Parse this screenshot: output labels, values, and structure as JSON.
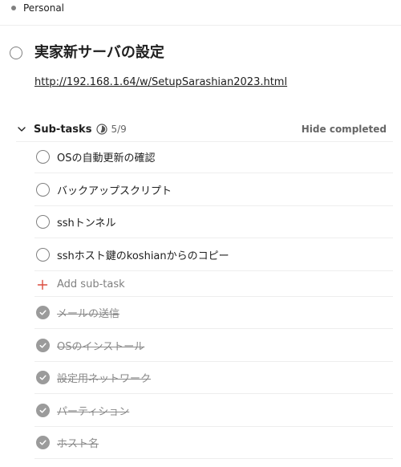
{
  "project": {
    "name": "Personal"
  },
  "task": {
    "title": "実家新サーバの設定",
    "link": "http://192.168.1.64/w/SetupSarashian2023.html"
  },
  "subtasks": {
    "label": "Sub-tasks",
    "count": "5/9",
    "progress": 0.5556,
    "hide_completed_label": "Hide completed",
    "add_label": "Add sub-task",
    "open": [
      {
        "label": "OSの自動更新の確認"
      },
      {
        "label": "バックアップスクリプト"
      },
      {
        "label": "sshトンネル"
      },
      {
        "label": "sshホスト鍵のkoshianからのコピー"
      }
    ],
    "completed": [
      {
        "label": "メールの送信"
      },
      {
        "label": "OSのインストール"
      },
      {
        "label": "設定用ネットワーク"
      },
      {
        "label": "パーティション"
      },
      {
        "label": "ホスト名"
      }
    ]
  },
  "colors": {
    "accent": "#db4c3f",
    "done_check": "#9b9b9b",
    "divider": "#eeeeee"
  }
}
